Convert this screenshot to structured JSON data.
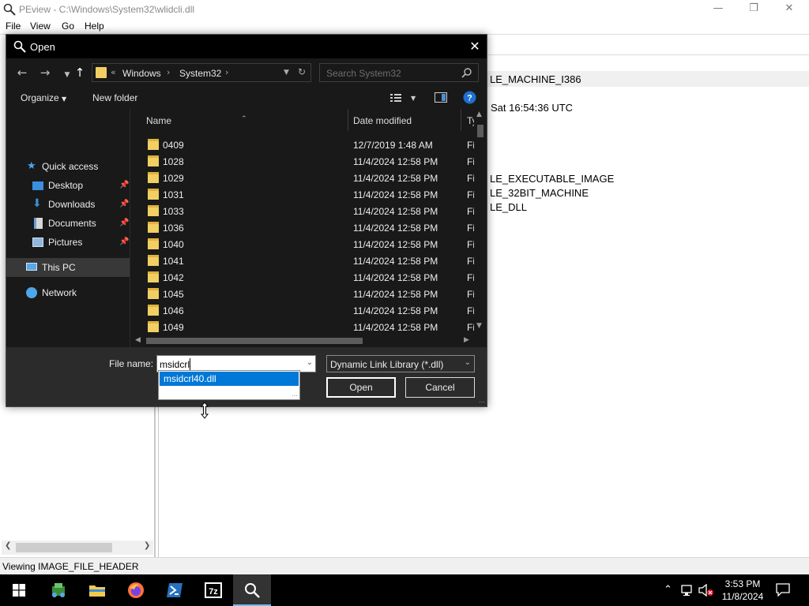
{
  "pe_window": {
    "title": "PEview - C:\\Windows\\System32\\wlidcli.dll",
    "menu": [
      "File",
      "View",
      "Go",
      "Help"
    ],
    "right_pane_lines": [
      "LE_MACHINE_I386",
      "Sat 16:54:36 UTC",
      "LE_EXECUTABLE_IMAGE",
      "LE_32BIT_MACHINE",
      "LE_DLL"
    ],
    "status": "Viewing IMAGE_FILE_HEADER"
  },
  "dialog": {
    "title": "Open",
    "address": {
      "overflow": "«",
      "crumbs": [
        "Windows",
        "System32"
      ]
    },
    "search_placeholder": "Search System32",
    "toolbar": {
      "organize": "Organize",
      "new_folder": "New folder"
    },
    "nav_pane": [
      {
        "label": "Quick access",
        "icon": "star-icon"
      },
      {
        "label": "Desktop",
        "icon": "desktop-icon"
      },
      {
        "label": "Downloads",
        "icon": "download-arrow-icon"
      },
      {
        "label": "Documents",
        "icon": "documents-icon"
      },
      {
        "label": "Pictures",
        "icon": "pictures-icon"
      },
      {
        "label": "This PC",
        "icon": "computer-icon"
      },
      {
        "label": "Network",
        "icon": "network-icon"
      }
    ],
    "columns": {
      "name": "Name",
      "date": "Date modified",
      "type": "Ty"
    },
    "files": [
      {
        "name": "0409",
        "date": "12/7/2019 1:48 AM",
        "type": "Fi"
      },
      {
        "name": "1028",
        "date": "11/4/2024 12:58 PM",
        "type": "Fi"
      },
      {
        "name": "1029",
        "date": "11/4/2024 12:58 PM",
        "type": "Fi"
      },
      {
        "name": "1031",
        "date": "11/4/2024 12:58 PM",
        "type": "Fi"
      },
      {
        "name": "1033",
        "date": "11/4/2024 12:58 PM",
        "type": "Fi"
      },
      {
        "name": "1036",
        "date": "11/4/2024 12:58 PM",
        "type": "Fi"
      },
      {
        "name": "1040",
        "date": "11/4/2024 12:58 PM",
        "type": "Fi"
      },
      {
        "name": "1041",
        "date": "11/4/2024 12:58 PM",
        "type": "Fi"
      },
      {
        "name": "1042",
        "date": "11/4/2024 12:58 PM",
        "type": "Fi"
      },
      {
        "name": "1045",
        "date": "11/4/2024 12:58 PM",
        "type": "Fi"
      },
      {
        "name": "1046",
        "date": "11/4/2024 12:58 PM",
        "type": "Fi"
      },
      {
        "name": "1049",
        "date": "11/4/2024 12:58 PM",
        "type": "Fi"
      }
    ],
    "file_name_label": "File name:",
    "file_name_value": "msidcrl",
    "autocomplete": [
      "msidcrl40.dll"
    ],
    "file_type": "Dynamic Link Library (*.dll)",
    "open_button": "Open",
    "cancel_button": "Cancel"
  },
  "taskbar": {
    "apps": [
      "start-windows-icon",
      "server-manager-icon",
      "file-explorer-icon",
      "firefox-icon",
      "powershell-icon",
      "7zip-icon",
      "peview-icon"
    ],
    "time": "3:53 PM",
    "date": "11/8/2024"
  },
  "colors": {
    "dialog_bg": "#2b2b2b",
    "dialog_pane": "#191919",
    "folder": "#f2cf62",
    "selection": "#0078d7",
    "taskbar": "#000000"
  }
}
